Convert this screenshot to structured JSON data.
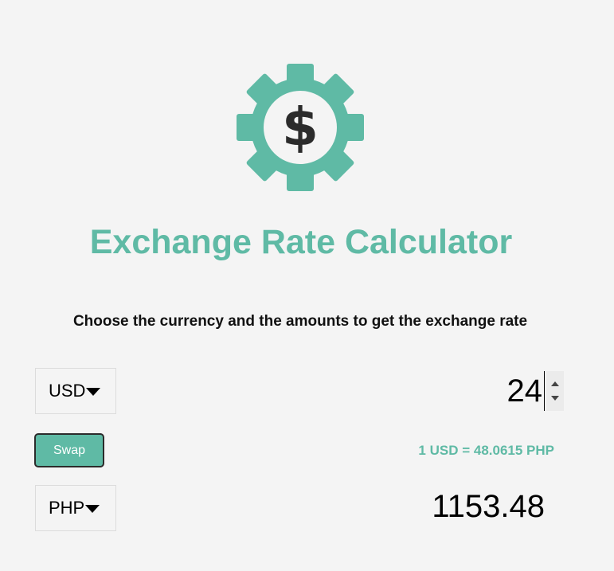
{
  "app": {
    "title": "Exchange Rate Calculator",
    "subtitle": "Choose the currency and the amounts to get the exchange rate",
    "logo_icon": "gear-dollar-icon",
    "accent_color": "#5fbaa5"
  },
  "currency_one": {
    "selected": "USD",
    "amount": "24"
  },
  "currency_two": {
    "selected": "PHP",
    "amount": "1153.48"
  },
  "swap": {
    "label": "Swap"
  },
  "rate": {
    "text": "1 USD = 48.0615 PHP"
  }
}
